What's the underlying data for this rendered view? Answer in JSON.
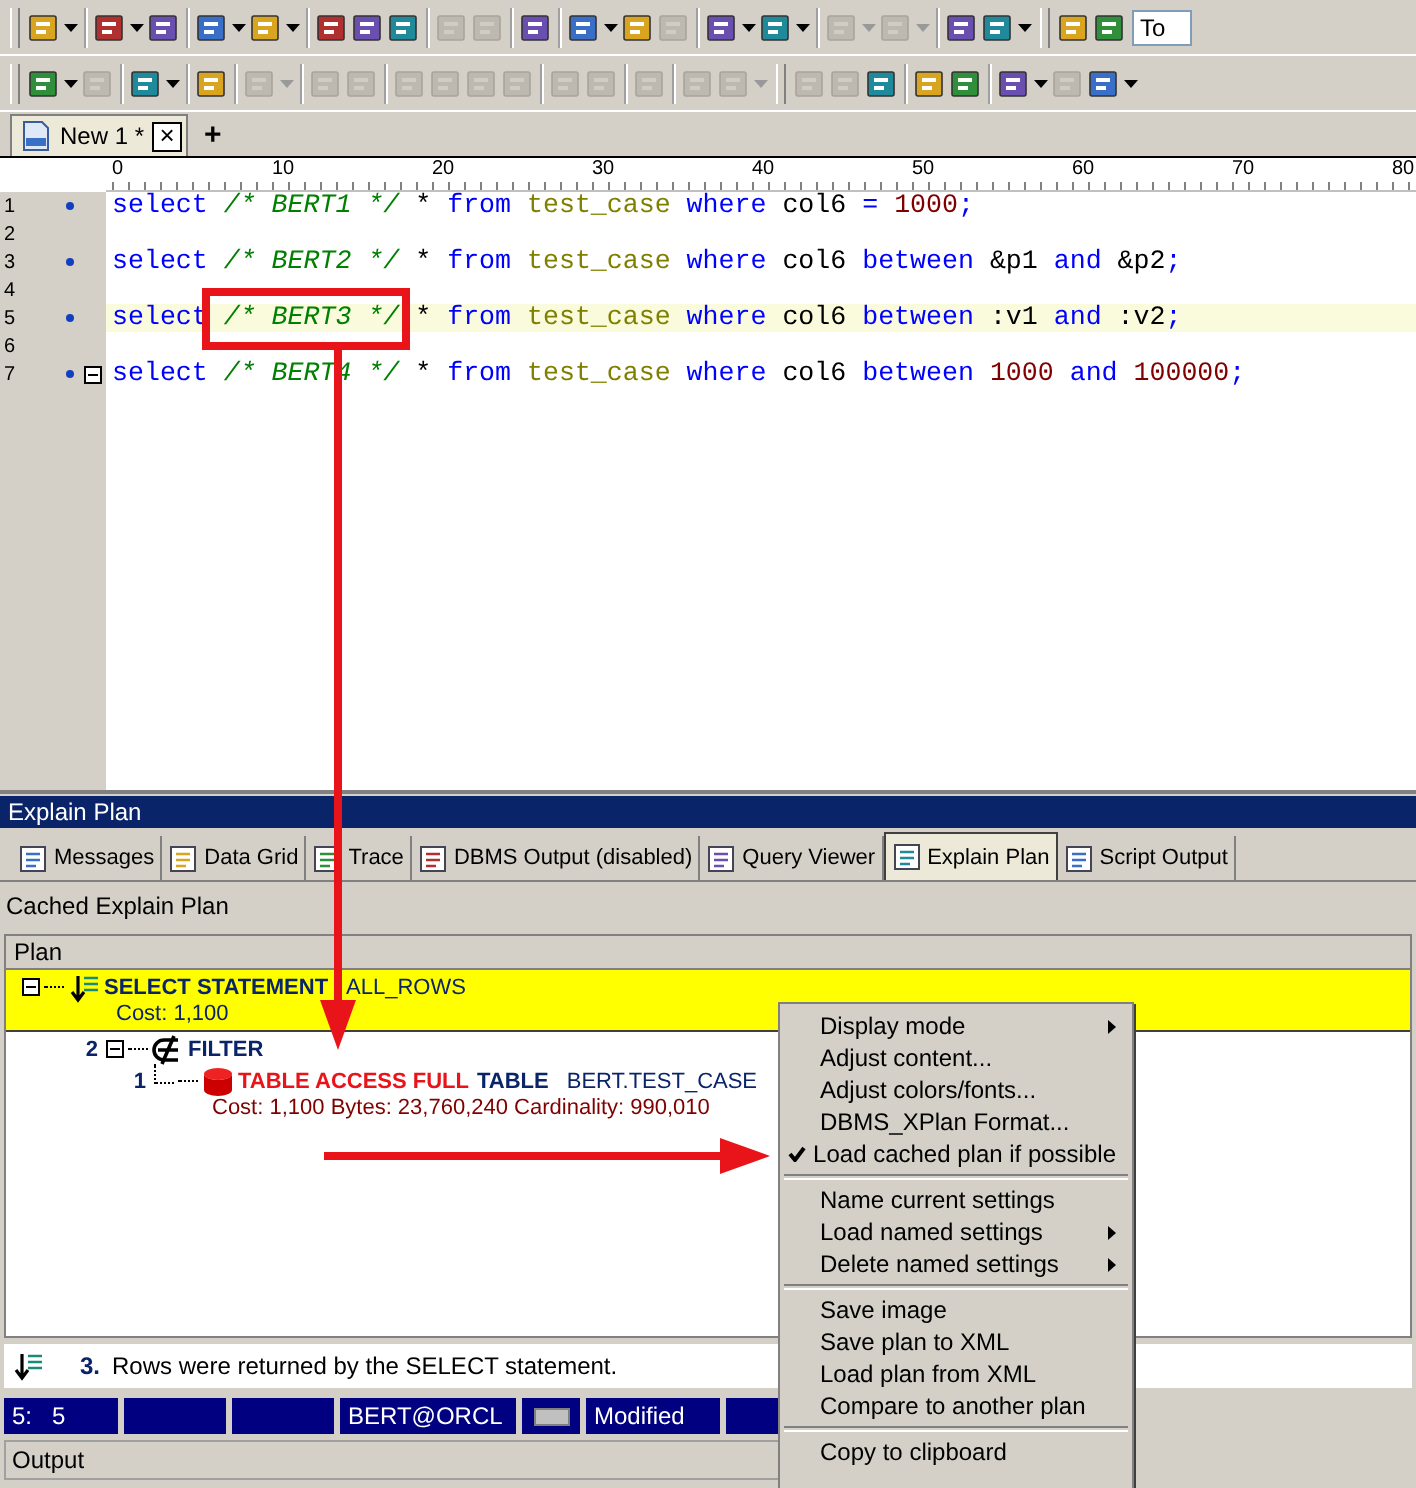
{
  "toolbar_1": [
    {
      "kind": "grip"
    },
    {
      "kind": "button",
      "disabled": false,
      "dropdown": true
    },
    {
      "kind": "separator"
    },
    {
      "kind": "button",
      "disabled": false,
      "dropdown": true
    },
    {
      "kind": "button",
      "disabled": false,
      "dropdown": false
    },
    {
      "kind": "separator"
    },
    {
      "kind": "button",
      "disabled": false,
      "dropdown": true
    },
    {
      "kind": "button",
      "disabled": false,
      "dropdown": true
    },
    {
      "kind": "separator"
    },
    {
      "kind": "button",
      "disabled": false,
      "dropdown": false
    },
    {
      "kind": "button",
      "disabled": false,
      "dropdown": false
    },
    {
      "kind": "button",
      "disabled": false,
      "dropdown": false
    },
    {
      "kind": "separator"
    },
    {
      "kind": "button",
      "disabled": true,
      "dropdown": false
    },
    {
      "kind": "button",
      "disabled": true,
      "dropdown": false
    },
    {
      "kind": "separator"
    },
    {
      "kind": "button",
      "disabled": false,
      "dropdown": false
    },
    {
      "kind": "separator"
    },
    {
      "kind": "button",
      "disabled": false,
      "dropdown": true
    },
    {
      "kind": "button",
      "disabled": false,
      "dropdown": false
    },
    {
      "kind": "button",
      "disabled": true,
      "dropdown": false
    },
    {
      "kind": "separator"
    },
    {
      "kind": "button",
      "disabled": false,
      "dropdown": true
    },
    {
      "kind": "button",
      "disabled": false,
      "dropdown": true
    },
    {
      "kind": "separator"
    },
    {
      "kind": "button",
      "disabled": true,
      "dropdown": true
    },
    {
      "kind": "button",
      "disabled": true,
      "dropdown": true
    },
    {
      "kind": "separator"
    },
    {
      "kind": "button",
      "disabled": false,
      "dropdown": false
    },
    {
      "kind": "button",
      "disabled": false,
      "dropdown": true
    },
    {
      "kind": "grip"
    },
    {
      "kind": "button",
      "disabled": false,
      "dropdown": false
    },
    {
      "kind": "button",
      "disabled": false,
      "dropdown": false
    }
  ],
  "search_field": {
    "value": "To"
  },
  "toolbar_2": [
    {
      "kind": "grip"
    },
    {
      "kind": "button",
      "disabled": false,
      "dropdown": true
    },
    {
      "kind": "button",
      "disabled": true,
      "dropdown": false
    },
    {
      "kind": "separator"
    },
    {
      "kind": "button",
      "disabled": false,
      "dropdown": true
    },
    {
      "kind": "separator"
    },
    {
      "kind": "button",
      "disabled": false,
      "dropdown": false
    },
    {
      "kind": "separator"
    },
    {
      "kind": "button",
      "disabled": true,
      "dropdown": true
    },
    {
      "kind": "separator"
    },
    {
      "kind": "button",
      "disabled": true,
      "dropdown": false
    },
    {
      "kind": "button",
      "disabled": true,
      "dropdown": false
    },
    {
      "kind": "separator"
    },
    {
      "kind": "button",
      "disabled": true,
      "dropdown": false
    },
    {
      "kind": "button",
      "disabled": true,
      "dropdown": false
    },
    {
      "kind": "button",
      "disabled": true,
      "dropdown": false
    },
    {
      "kind": "button",
      "disabled": true,
      "dropdown": false
    },
    {
      "kind": "separator"
    },
    {
      "kind": "button",
      "disabled": true,
      "dropdown": false
    },
    {
      "kind": "button",
      "disabled": true,
      "dropdown": false
    },
    {
      "kind": "separator"
    },
    {
      "kind": "button",
      "disabled": true,
      "dropdown": false
    },
    {
      "kind": "separator"
    },
    {
      "kind": "button",
      "disabled": true,
      "dropdown": false
    },
    {
      "kind": "button",
      "disabled": true,
      "dropdown": true
    },
    {
      "kind": "grip"
    },
    {
      "kind": "button",
      "disabled": true,
      "dropdown": false
    },
    {
      "kind": "button",
      "disabled": true,
      "dropdown": false
    },
    {
      "kind": "button",
      "disabled": false,
      "dropdown": false
    },
    {
      "kind": "separator"
    },
    {
      "kind": "button",
      "disabled": false,
      "dropdown": false
    },
    {
      "kind": "button",
      "disabled": false,
      "dropdown": false
    },
    {
      "kind": "separator"
    },
    {
      "kind": "button",
      "disabled": false,
      "dropdown": true
    },
    {
      "kind": "button",
      "disabled": true,
      "dropdown": false
    },
    {
      "kind": "button",
      "disabled": false,
      "dropdown": true
    }
  ],
  "document_tabs": [
    {
      "label": "New 1 *",
      "selected": true,
      "close": "×"
    }
  ],
  "new_tab_button": "+",
  "ruler": [
    "0",
    "10",
    "20",
    "30",
    "40",
    "50",
    "60",
    "70",
    "80"
  ],
  "editor_lines": [
    {
      "number": "1",
      "marker": true,
      "fold": false,
      "current": false,
      "tokens": [
        {
          "kind": "keyword",
          "text": "select "
        },
        {
          "kind": "comment",
          "text": "/* BERT1 */ "
        },
        {
          "kind": "plain",
          "text": "* "
        },
        {
          "kind": "keyword",
          "text": "from "
        },
        {
          "kind": "table",
          "text": "test_case "
        },
        {
          "kind": "keyword",
          "text": "where "
        },
        {
          "kind": "plain",
          "text": "col6 "
        },
        {
          "kind": "keyword",
          "text": "= "
        },
        {
          "kind": "number",
          "text": "1000"
        },
        {
          "kind": "keyword",
          "text": ";"
        }
      ]
    },
    {
      "number": "2",
      "marker": false,
      "fold": false,
      "current": false
    },
    {
      "number": "3",
      "marker": true,
      "fold": false,
      "current": false,
      "tokens": [
        {
          "kind": "keyword",
          "text": "select "
        },
        {
          "kind": "comment",
          "text": "/* BERT2 */ "
        },
        {
          "kind": "plain",
          "text": "* "
        },
        {
          "kind": "keyword",
          "text": "from "
        },
        {
          "kind": "table",
          "text": "test_case "
        },
        {
          "kind": "keyword",
          "text": "where "
        },
        {
          "kind": "plain",
          "text": "col6 "
        },
        {
          "kind": "keyword",
          "text": "between "
        },
        {
          "kind": "plain",
          "text": "&p1 "
        },
        {
          "kind": "keyword",
          "text": "and "
        },
        {
          "kind": "plain",
          "text": "&p2"
        },
        {
          "kind": "keyword",
          "text": ";"
        }
      ]
    },
    {
      "number": "4",
      "marker": false,
      "fold": false,
      "current": false
    },
    {
      "number": "5",
      "marker": true,
      "fold": false,
      "current": true,
      "tokens": [
        {
          "kind": "keyword",
          "text": "select "
        },
        {
          "kind": "comment",
          "text": "/* BERT3 */ "
        },
        {
          "kind": "plain",
          "text": "* "
        },
        {
          "kind": "keyword",
          "text": "from "
        },
        {
          "kind": "table",
          "text": "test_case "
        },
        {
          "kind": "keyword",
          "text": "where "
        },
        {
          "kind": "plain",
          "text": "col6 "
        },
        {
          "kind": "keyword",
          "text": "between "
        },
        {
          "kind": "plain",
          "text": ":v1 "
        },
        {
          "kind": "keyword",
          "text": "and "
        },
        {
          "kind": "plain",
          "text": ":v2"
        },
        {
          "kind": "keyword",
          "text": ";"
        }
      ]
    },
    {
      "number": "6",
      "marker": false,
      "fold": false,
      "current": false
    },
    {
      "number": "7",
      "marker": true,
      "fold": true,
      "current": false,
      "tokens": [
        {
          "kind": "keyword",
          "text": "select "
        },
        {
          "kind": "comment",
          "text": "/* BERT4 */ "
        },
        {
          "kind": "plain",
          "text": "* "
        },
        {
          "kind": "keyword",
          "text": "from "
        },
        {
          "kind": "table",
          "text": "test_case "
        },
        {
          "kind": "keyword",
          "text": "where "
        },
        {
          "kind": "plain",
          "text": "col6 "
        },
        {
          "kind": "keyword",
          "text": "between "
        },
        {
          "kind": "number",
          "text": "1000 "
        },
        {
          "kind": "keyword",
          "text": "and "
        },
        {
          "kind": "number",
          "text": "100000"
        },
        {
          "kind": "keyword",
          "text": ";"
        }
      ]
    }
  ],
  "panel": {
    "title": "Explain Plan",
    "tabs": [
      {
        "label": "Messages",
        "selected": false
      },
      {
        "label": "Data Grid",
        "selected": false
      },
      {
        "label": "Trace",
        "selected": false
      },
      {
        "label": "DBMS Output (disabled)",
        "selected": false
      },
      {
        "label": "Query Viewer",
        "selected": false
      },
      {
        "label": "Explain Plan",
        "selected": true
      },
      {
        "label": "Script Output",
        "selected": false
      }
    ],
    "caption": "Cached Explain Plan",
    "plan_header": "Plan",
    "plan": [
      {
        "kind": "select",
        "operation": "SELECT STATEMENT",
        "object": "ALL_ROWS",
        "details": "Cost: 1,100",
        "selected": true,
        "highlight": false,
        "expanded": true,
        "children": [
          {
            "kind": "filter",
            "step": "2",
            "operation": "FILTER",
            "selected": false,
            "highlight": false,
            "expanded": true,
            "children": [
              {
                "kind": "table_access",
                "step": "1",
                "operation": "TABLE ACCESS FULL",
                "options": "TABLE",
                "object": "BERT.TEST_CASE",
                "details": "Cost: 1,100  Bytes: 23,760,240  Cardinality: 990,010",
                "selected": false,
                "highlight": true,
                "expanded": false
              }
            ]
          }
        ]
      }
    ],
    "message": {
      "number": "3.",
      "text": "Rows were returned by the SELECT statement."
    }
  },
  "status_bar": [
    {
      "kind": "text",
      "text": "5:   5"
    },
    {
      "kind": "blank"
    },
    {
      "kind": "blank"
    },
    {
      "kind": "text",
      "text": "BERT@ORCL"
    },
    {
      "kind": "indicator"
    },
    {
      "kind": "text",
      "text": "Modified"
    },
    {
      "kind": "blank"
    }
  ],
  "output_title": "Output",
  "context_menu": [
    {
      "kind": "item",
      "label": "Display mode",
      "checked": false,
      "submenu": true
    },
    {
      "kind": "item",
      "label": "Adjust content...",
      "checked": false,
      "submenu": false
    },
    {
      "kind": "item",
      "label": "Adjust colors/fonts...",
      "checked": false,
      "submenu": false
    },
    {
      "kind": "item",
      "label": "DBMS_XPlan Format...",
      "checked": false,
      "submenu": false
    },
    {
      "kind": "item",
      "label": "Load cached plan if possible",
      "checked": true,
      "submenu": false
    },
    {
      "kind": "separator"
    },
    {
      "kind": "item",
      "label": "Name current settings",
      "checked": false,
      "submenu": false
    },
    {
      "kind": "item",
      "label": "Load named settings",
      "checked": false,
      "submenu": true
    },
    {
      "kind": "item",
      "label": "Delete named settings",
      "checked": false,
      "submenu": true
    },
    {
      "kind": "separator"
    },
    {
      "kind": "item",
      "label": "Save image",
      "checked": false,
      "submenu": false
    },
    {
      "kind": "item",
      "label": "Save plan to XML",
      "checked": false,
      "submenu": false
    },
    {
      "kind": "item",
      "label": "Load plan from XML",
      "checked": false,
      "submenu": false
    },
    {
      "kind": "item",
      "label": "Compare to another plan",
      "checked": false,
      "submenu": false
    },
    {
      "kind": "separator"
    },
    {
      "kind": "item",
      "label": "Copy to clipboard",
      "checked": false,
      "submenu": false
    }
  ]
}
